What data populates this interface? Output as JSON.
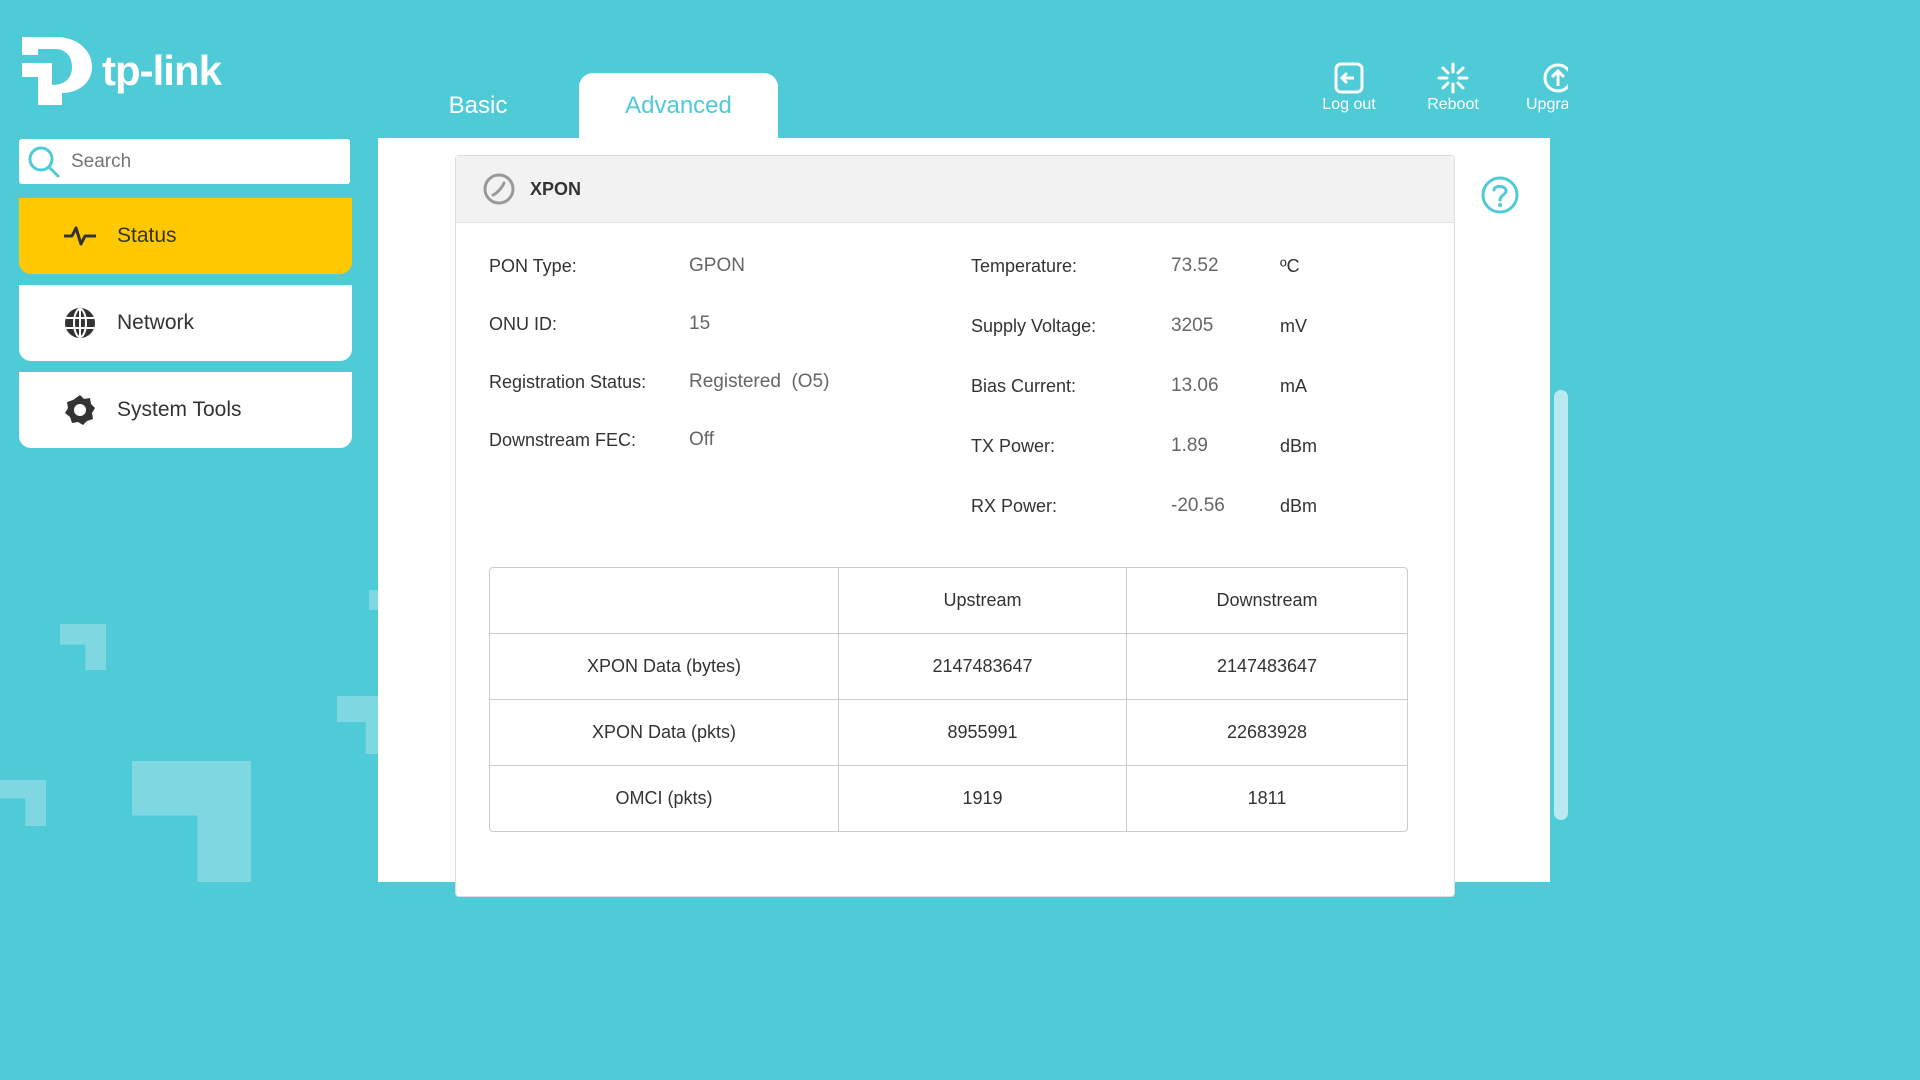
{
  "brand": {
    "name": "tp-link"
  },
  "tabs": [
    {
      "label": "Basic"
    },
    {
      "label": "Advanced",
      "active": true
    }
  ],
  "actions": [
    {
      "label": "Log out",
      "icon": "logout-icon"
    },
    {
      "label": "Reboot",
      "icon": "reboot-icon"
    },
    {
      "label": "Upgrade",
      "icon": "upgrade-icon"
    }
  ],
  "search": {
    "placeholder": "Search"
  },
  "sidebar": {
    "items": [
      {
        "label": "Status",
        "icon": "pulse-icon",
        "active": true
      },
      {
        "label": "Network",
        "icon": "globe-icon"
      },
      {
        "label": "System Tools",
        "icon": "gear-icon"
      }
    ]
  },
  "panel": {
    "title": "XPON",
    "left": [
      {
        "label": "PON Type:",
        "value": "GPON"
      },
      {
        "label": "ONU ID:",
        "value": "15"
      },
      {
        "label": "Registration Status:",
        "value": "Registered  (O5)"
      },
      {
        "label": "Downstream FEC:",
        "value": "Off"
      }
    ],
    "right": [
      {
        "label": "Temperature:",
        "value": "73.52",
        "unit": "ºC"
      },
      {
        "label": "Supply Voltage:",
        "value": "3205",
        "unit": "mV"
      },
      {
        "label": "Bias Current:",
        "value": "13.06",
        "unit": "mA"
      },
      {
        "label": "TX Power:",
        "value": "1.89",
        "unit": "dBm"
      },
      {
        "label": "RX Power:",
        "value": "-20.56",
        "unit": "dBm"
      }
    ],
    "table": {
      "headers": [
        "",
        "Upstream",
        "Downstream"
      ],
      "rows": [
        [
          "XPON Data (bytes)",
          "2147483647",
          "2147483647"
        ],
        [
          "XPON Data (pkts)",
          "8955991",
          "22683928"
        ],
        [
          "OMCI (pkts)",
          "1919",
          "1811"
        ]
      ]
    }
  },
  "colors": {
    "accent": "#4ecbd7",
    "active_menu": "#ffc800"
  }
}
